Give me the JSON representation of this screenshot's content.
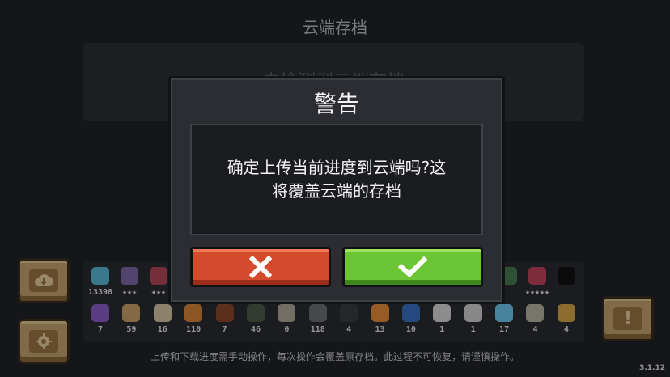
{
  "header": {
    "title": "云端存档"
  },
  "cloud_box": {
    "text": "未检测到云端存档"
  },
  "items_row1": [
    {
      "icon": "blue-gems-icon",
      "count": "13398",
      "color": "#5ab7d6"
    },
    {
      "icon": "hooded-ghost-icon",
      "count": "★★★",
      "color": "#7d6aa8"
    },
    {
      "icon": "red-hood-character-icon",
      "count": "★★★",
      "color": "#b7475b"
    },
    {
      "icon": "blank-slot",
      "count": "",
      "color": "#2a2c31"
    },
    {
      "icon": "blank-slot",
      "count": "",
      "color": "#2a2c31"
    },
    {
      "icon": "blank-slot",
      "count": "",
      "color": "#2a2c31"
    },
    {
      "icon": "blank-slot",
      "count": "",
      "color": "#2a2c31"
    },
    {
      "icon": "blank-slot",
      "count": "",
      "color": "#2a2c31"
    },
    {
      "icon": "blank-slot",
      "count": "",
      "color": "#2a2c31"
    },
    {
      "icon": "blank-slot",
      "count": "",
      "color": "#2a2c31"
    },
    {
      "icon": "blank-slot",
      "count": "",
      "color": "#2a2c31"
    },
    {
      "icon": "blank-slot",
      "count": "",
      "color": "#2a2c31"
    },
    {
      "icon": "blank-slot",
      "count": "",
      "color": "#2a2c31"
    },
    {
      "icon": "blank-slot",
      "count": "",
      "color": "#2a2c31"
    },
    {
      "icon": "green-hood-character-icon",
      "count": "",
      "color": "#4a7c53"
    },
    {
      "icon": "pink-hair-character-icon",
      "count": "★★★★★",
      "color": "#c0455f"
    },
    {
      "icon": "dark-shadow-icon",
      "count": "",
      "color": "#111111"
    }
  ],
  "items_row2": [
    {
      "icon": "purple-crystal-icon",
      "count": "7",
      "color": "#8a5fc8"
    },
    {
      "icon": "wood-plank-icon",
      "count": "59",
      "color": "#c9a36a"
    },
    {
      "icon": "sack-icon",
      "count": "16",
      "color": "#d8c7a4"
    },
    {
      "icon": "orange-ore-icon",
      "count": "110",
      "color": "#d9853a"
    },
    {
      "icon": "meat-icon",
      "count": "7",
      "color": "#8a4b2c"
    },
    {
      "icon": "dark-bar-icon",
      "count": "46",
      "color": "#4d5d4a"
    },
    {
      "icon": "scroll-icon",
      "count": "0",
      "color": "#b0aa9a"
    },
    {
      "icon": "coal-icon",
      "count": "118",
      "color": "#6c6f74"
    },
    {
      "icon": "black-stone-icon",
      "count": "4",
      "color": "#3a3c40"
    },
    {
      "icon": "orange-shard-icon",
      "count": "13",
      "color": "#e88d3a"
    },
    {
      "icon": "blue-orb-icon",
      "count": "10",
      "color": "#3a6fc2"
    },
    {
      "icon": "tile-icon",
      "count": "1",
      "color": "#d7d7d7"
    },
    {
      "icon": "blueprint-icon",
      "count": "1",
      "color": "#cfcfcf"
    },
    {
      "icon": "blue-crystal-icon",
      "count": "17",
      "color": "#6fc6ef"
    },
    {
      "icon": "paper-icon",
      "count": "4",
      "color": "#b9b4a4"
    },
    {
      "icon": "straw-hat-icon",
      "count": "4",
      "color": "#d6a84a"
    }
  ],
  "footer": {
    "text": "上传和下载进度需手动操作，每次操作会覆盖原存档。此过程不可恢复，请谨慎操作。"
  },
  "version": "3.1.12",
  "dialog": {
    "title": "警告",
    "line1": "确定上传当前进度到云端吗?这",
    "line2": "将覆盖云端的存档",
    "cancel_icon": "x-icon",
    "confirm_icon": "check-icon"
  },
  "colors": {
    "background": "#202227",
    "cancel": "#d44a2c",
    "confirm": "#6cc534",
    "side_button": "#c7a46e"
  }
}
